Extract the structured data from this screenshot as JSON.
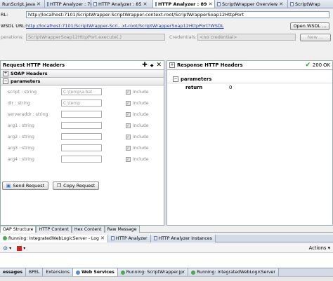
{
  "tabs": [
    {
      "label": "RunScript.java"
    },
    {
      "label": "HTTP Analyzer : 78"
    },
    {
      "label": "HTTP Analyzer : 85"
    },
    {
      "label": "HTTP Analyzer : 89"
    },
    {
      "label": "ScriptWrapper Overview"
    },
    {
      "label": "ScriptWrap"
    }
  ],
  "url": {
    "label": "RL:",
    "value": "http://localhost:7101/ScriptWrapper-ScriptWrapper-context-root/ScriptWrapperSoap12HttpPort"
  },
  "wsdl": {
    "label": "WSDL URL:",
    "value": "http://localhost:7101/ScriptWrapper-Scri...xt-root/ScriptWrapperSoap12HttpPort?WSDL",
    "button": "Open WSDL ..."
  },
  "operation": {
    "label": "perations:",
    "value": "ScriptWrapperSoap12HttpPort.execute(,)",
    "cred_label": "Credentials:",
    "cred_value": "<no credential>",
    "new_button": "New ..."
  },
  "request": {
    "title": "Request HTTP Headers",
    "soap_headers": "SOAP Headers",
    "parameters": "parameters",
    "params": [
      {
        "name": "script : string",
        "value": "C:\\temp\\a.bat",
        "include": "Include"
      },
      {
        "name": "dir : string",
        "value": "C:\\temp",
        "include": "Include"
      },
      {
        "name": "serveraddr : string",
        "value": "",
        "include": "Include"
      },
      {
        "name": "arg1 : string",
        "value": "",
        "include": "Include"
      },
      {
        "name": "arg2 : string",
        "value": "",
        "include": "Include"
      },
      {
        "name": "arg3 : string",
        "value": "",
        "include": "Include"
      },
      {
        "name": "arg4 : string",
        "value": "",
        "include": "Include"
      }
    ],
    "send_button": "Send Request",
    "copy_button": "Copy Request"
  },
  "response": {
    "title": "Response HTTP Headers",
    "status": "200 OK",
    "parameters": "parameters",
    "return_label": "return",
    "return_value": "0"
  },
  "view_tabs": [
    {
      "label": "OAP Structure"
    },
    {
      "label": "HTTP Content"
    },
    {
      "label": "Hex Content"
    },
    {
      "label": "Raw Message"
    }
  ],
  "log_tabs": [
    {
      "label": "Running: IntegratedWebLogicServer - Log"
    },
    {
      "label": "HTTP Analyzer"
    },
    {
      "label": "HTTP Analyzer Instances"
    }
  ],
  "actions_label": "Actions",
  "bottom_tabs": [
    {
      "label": "essages"
    },
    {
      "label": "BPEL"
    },
    {
      "label": "Extensions"
    },
    {
      "label": "Web Services"
    },
    {
      "label": "Running: ScriptWrapper.jpr"
    },
    {
      "label": "Running: IntegratedWebLogicServer"
    }
  ],
  "colors": {
    "accent": "#1a3fa8",
    "ok": "#2f9b2f",
    "stop": "#d42020",
    "tabActive": "#ffffff"
  }
}
